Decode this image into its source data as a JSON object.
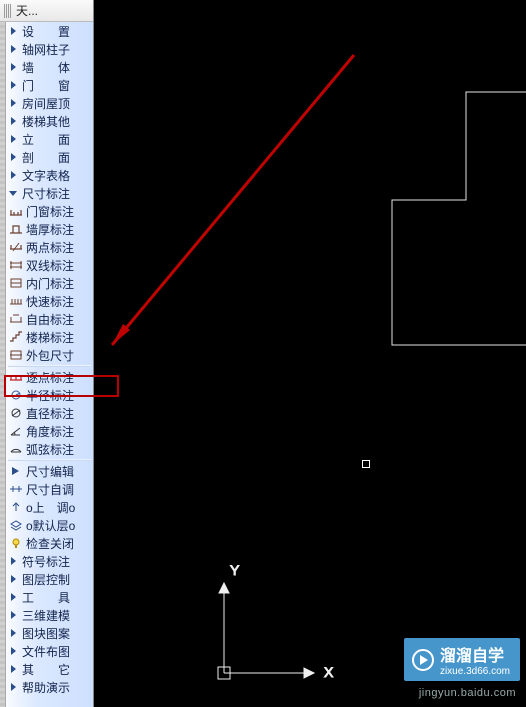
{
  "panel": {
    "title": "天..."
  },
  "categories": [
    {
      "label": "设　　置",
      "expanded": false
    },
    {
      "label": "轴网柱子",
      "expanded": false
    },
    {
      "label": "墙　　体",
      "expanded": false
    },
    {
      "label": "门　　窗",
      "expanded": false
    },
    {
      "label": "房间屋顶",
      "expanded": false
    },
    {
      "label": "楼梯其他",
      "expanded": false
    },
    {
      "label": "立　　面",
      "expanded": false
    },
    {
      "label": "剖　　面",
      "expanded": false
    },
    {
      "label": "文字表格",
      "expanded": false
    },
    {
      "label": "尺寸标注",
      "expanded": true
    }
  ],
  "dimension_items": [
    {
      "label": "门窗标注",
      "icon_color": "#6b3f2e"
    },
    {
      "label": "墙厚标注",
      "icon_color": "#6b3f2e"
    },
    {
      "label": "两点标注",
      "icon_color": "#6b3f2e"
    },
    {
      "label": "双线标注",
      "icon_color": "#6b3f2e"
    },
    {
      "label": "内门标注",
      "icon_color": "#6b3f2e"
    },
    {
      "label": "快速标注",
      "icon_color": "#6b3f2e"
    },
    {
      "label": "自由标注",
      "icon_color": "#6b3f2e"
    },
    {
      "label": "楼梯标注",
      "icon_color": "#6b3f2e"
    },
    {
      "label": "外包尺寸",
      "icon_color": "#6b3f2e"
    },
    {
      "label": "逐点标注",
      "icon_color": "#c02020"
    },
    {
      "label": "半径标注",
      "icon_color": "#3a5c9e"
    },
    {
      "label": "直径标注",
      "icon_color": "#333"
    },
    {
      "label": "角度标注",
      "icon_color": "#333"
    },
    {
      "label": "弧弦标注",
      "icon_color": "#333"
    },
    {
      "label": "尺寸编辑",
      "icon_color": "#2a4e8a"
    },
    {
      "label": "尺寸自调",
      "icon_color": "#2a4e8a"
    },
    {
      "label": "o上　调o",
      "icon_color": "#2a4e8a"
    },
    {
      "label": "o默认层o",
      "icon_color": "#2a4e8a"
    },
    {
      "label": "检查关闭",
      "icon_color": "#d8b400"
    }
  ],
  "categories_after": [
    {
      "label": "符号标注",
      "expanded": false
    },
    {
      "label": "图层控制",
      "expanded": false
    },
    {
      "label": "工　　具",
      "expanded": false
    },
    {
      "label": "三维建模",
      "expanded": false
    },
    {
      "label": "图块图案",
      "expanded": false
    },
    {
      "label": "文件布图",
      "expanded": false
    },
    {
      "label": "其　　它",
      "expanded": false
    },
    {
      "label": "帮助演示",
      "expanded": false
    }
  ],
  "axes": {
    "x": "X",
    "y": "Y"
  },
  "brand": {
    "name": "溜溜自学",
    "url": "zixue.3d66.com"
  },
  "wm_url": "jingyun.baidu.com",
  "highlight_index": 9
}
